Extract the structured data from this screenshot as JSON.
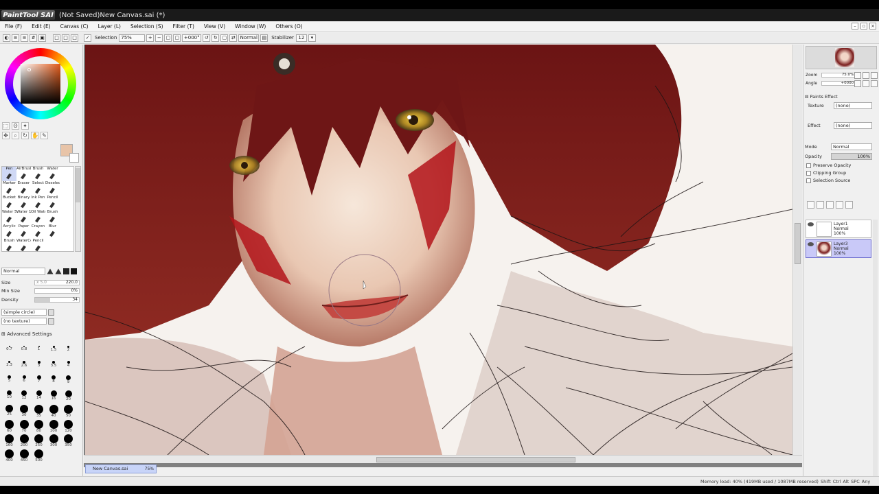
{
  "app": {
    "logo_text": "PaintTool SAI",
    "window_title": "(Not Saved)New Canvas.sai (*)"
  },
  "menu": {
    "items": [
      "File (F)",
      "Edit (E)",
      "Canvas (C)",
      "Layer (L)",
      "Selection (S)",
      "Filter (T)",
      "View (V)",
      "Window (W)",
      "Others (O)"
    ]
  },
  "toolbar": {
    "selection_label": "Selection",
    "zoom_value": "75%",
    "angle_value": "+000°",
    "blend_mode": "Normal",
    "stabilizer_label": "Stabilizer",
    "stabilizer_value": "12"
  },
  "tools": {
    "brushes": [
      {
        "label": "Pen",
        "selected": true
      },
      {
        "label": "AirBrush"
      },
      {
        "label": "Brush"
      },
      {
        "label": "Water"
      },
      {
        "label": ""
      },
      {
        "label": "Marker"
      },
      {
        "label": "Eraser"
      },
      {
        "label": "Select"
      },
      {
        "label": "Deselect"
      },
      {
        "label": ""
      },
      {
        "label": "Bucket"
      },
      {
        "label": "Binary"
      },
      {
        "label": "Ink Pen"
      },
      {
        "label": "Pencil"
      },
      {
        "label": ""
      },
      {
        "label": "Water 5"
      },
      {
        "label": "Water 10"
      },
      {
        "label": "Oil Water"
      },
      {
        "label": "Brush"
      },
      {
        "label": ""
      },
      {
        "label": "Acrylic"
      },
      {
        "label": "Paper"
      },
      {
        "label": "Crayon"
      },
      {
        "label": "Blur"
      },
      {
        "label": ""
      },
      {
        "label": "Brush"
      },
      {
        "label": "WaterCo"
      },
      {
        "label": "Pencil"
      },
      {
        "label": ""
      },
      {
        "label": ""
      }
    ],
    "brush_blend": "Normal",
    "size_label": "Size",
    "size_mult": "x 5.0",
    "size_value": "220.0",
    "min_size_label": "Min Size",
    "min_size_value": "0%",
    "density_label": "Density",
    "density_value": "34",
    "density_fraction": 0.34,
    "shape": "(simple circle)",
    "texture": "(no texture)",
    "advanced_label": "Advanced Settings",
    "sizes": [
      "0.7",
      "0.8",
      "1",
      "1.5",
      "2",
      "2.3",
      "2.6",
      "3",
      "3.5",
      "4",
      "5",
      "6",
      "7",
      "8",
      "9",
      "10",
      "12",
      "14",
      "16",
      "20",
      "25",
      "30",
      "35",
      "40",
      "50",
      "60",
      "70",
      "80",
      "100",
      "120",
      "160",
      "200",
      "250",
      "300",
      "350",
      "400",
      "450",
      "500"
    ]
  },
  "navigator": {
    "zoom_label": "Zoom",
    "zoom_value": "75.0%",
    "angle_label": "Angle",
    "angle_value": "+0000"
  },
  "paint_effect": {
    "header": "Paints Effect",
    "texture_label": "Texture",
    "texture_value": "(none)",
    "effect_label": "Effect",
    "effect_value": "(none)",
    "mode_label": "Mode",
    "mode_value": "Normal",
    "opacity_label": "Opacity",
    "opacity_value": "100%",
    "preserve_opacity": "Preserve Opacity",
    "clipping_group": "Clipping Group",
    "selection_source": "Selection Source"
  },
  "layers": [
    {
      "name": "Layer1",
      "mode": "Normal",
      "opacity": "100%",
      "selected": false
    },
    {
      "name": "Layer3",
      "mode": "Normal",
      "opacity": "100%",
      "selected": true
    }
  ],
  "canvas_tab": {
    "name": "New Canvas.sai",
    "zoom": "75%"
  },
  "status": {
    "memory": "Memory load: 40% (419MB used / 1087MB reserved)",
    "keys": [
      "Shift",
      "Ctrl",
      "Alt",
      "SPC",
      "Any"
    ]
  }
}
